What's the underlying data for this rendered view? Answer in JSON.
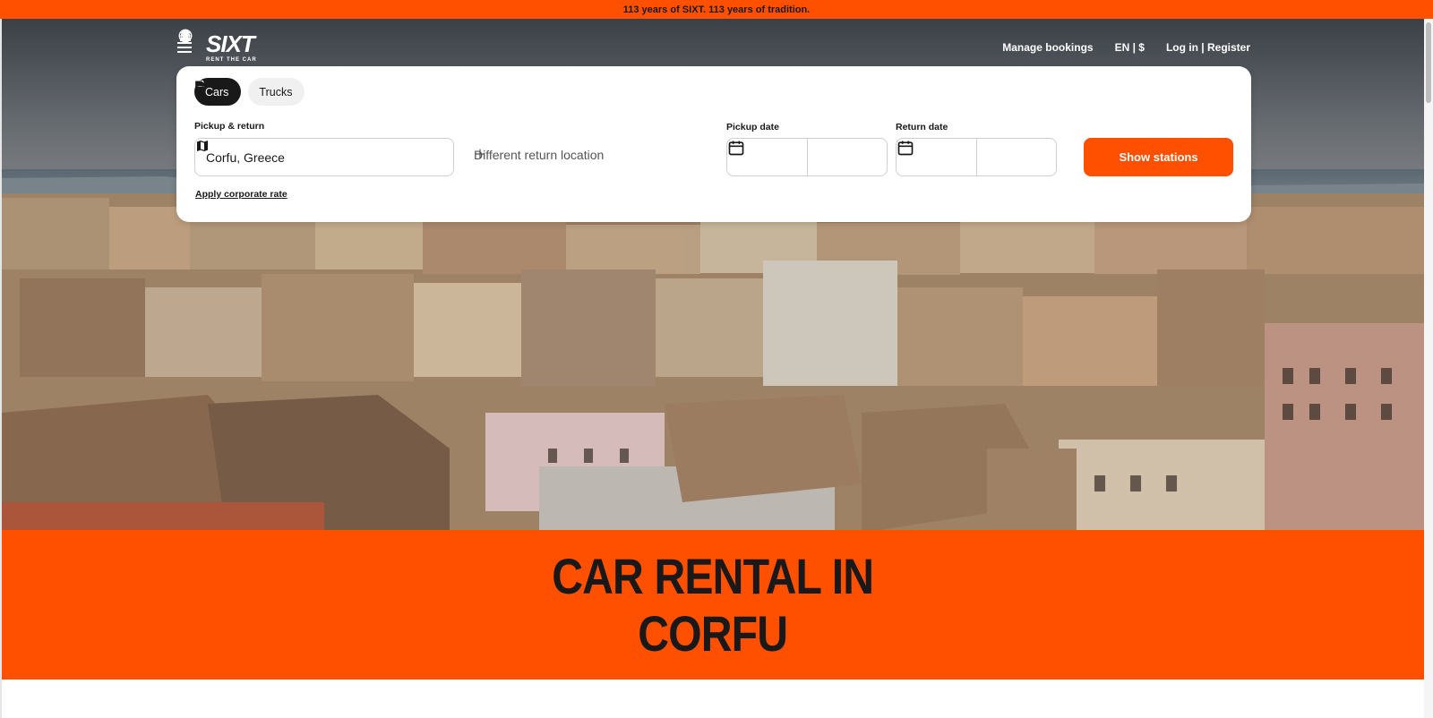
{
  "promo": {
    "text": "113 years of SIXT. 113 years of tradition."
  },
  "brand": {
    "name": "SIXT",
    "tagline": "RENT THE CAR",
    "accent": "#ff5000",
    "dark": "#191919"
  },
  "nav": {
    "menu_icon": "hamburger-icon",
    "manage_bookings": "Manage bookings",
    "language_currency": "EN | $",
    "login": "Log in | Register"
  },
  "booking": {
    "tabs": [
      {
        "label": "Cars",
        "icon": "car-icon",
        "active": true
      },
      {
        "label": "Trucks",
        "icon": "truck-icon",
        "active": false
      }
    ],
    "pickup_return_label": "Pickup & return",
    "location_value": "Corfu, Greece",
    "different_return": "Different return location",
    "corporate_rate": "Apply corporate rate",
    "pickup_date_label": "Pickup date",
    "return_date_label": "Return date",
    "pickup_date_value": "",
    "pickup_time_value": "",
    "return_date_value": "",
    "return_time_value": "",
    "submit": "Show stations"
  },
  "hero": {
    "title_line1": "CAR RENTAL IN",
    "title_line2": "CORFU"
  }
}
